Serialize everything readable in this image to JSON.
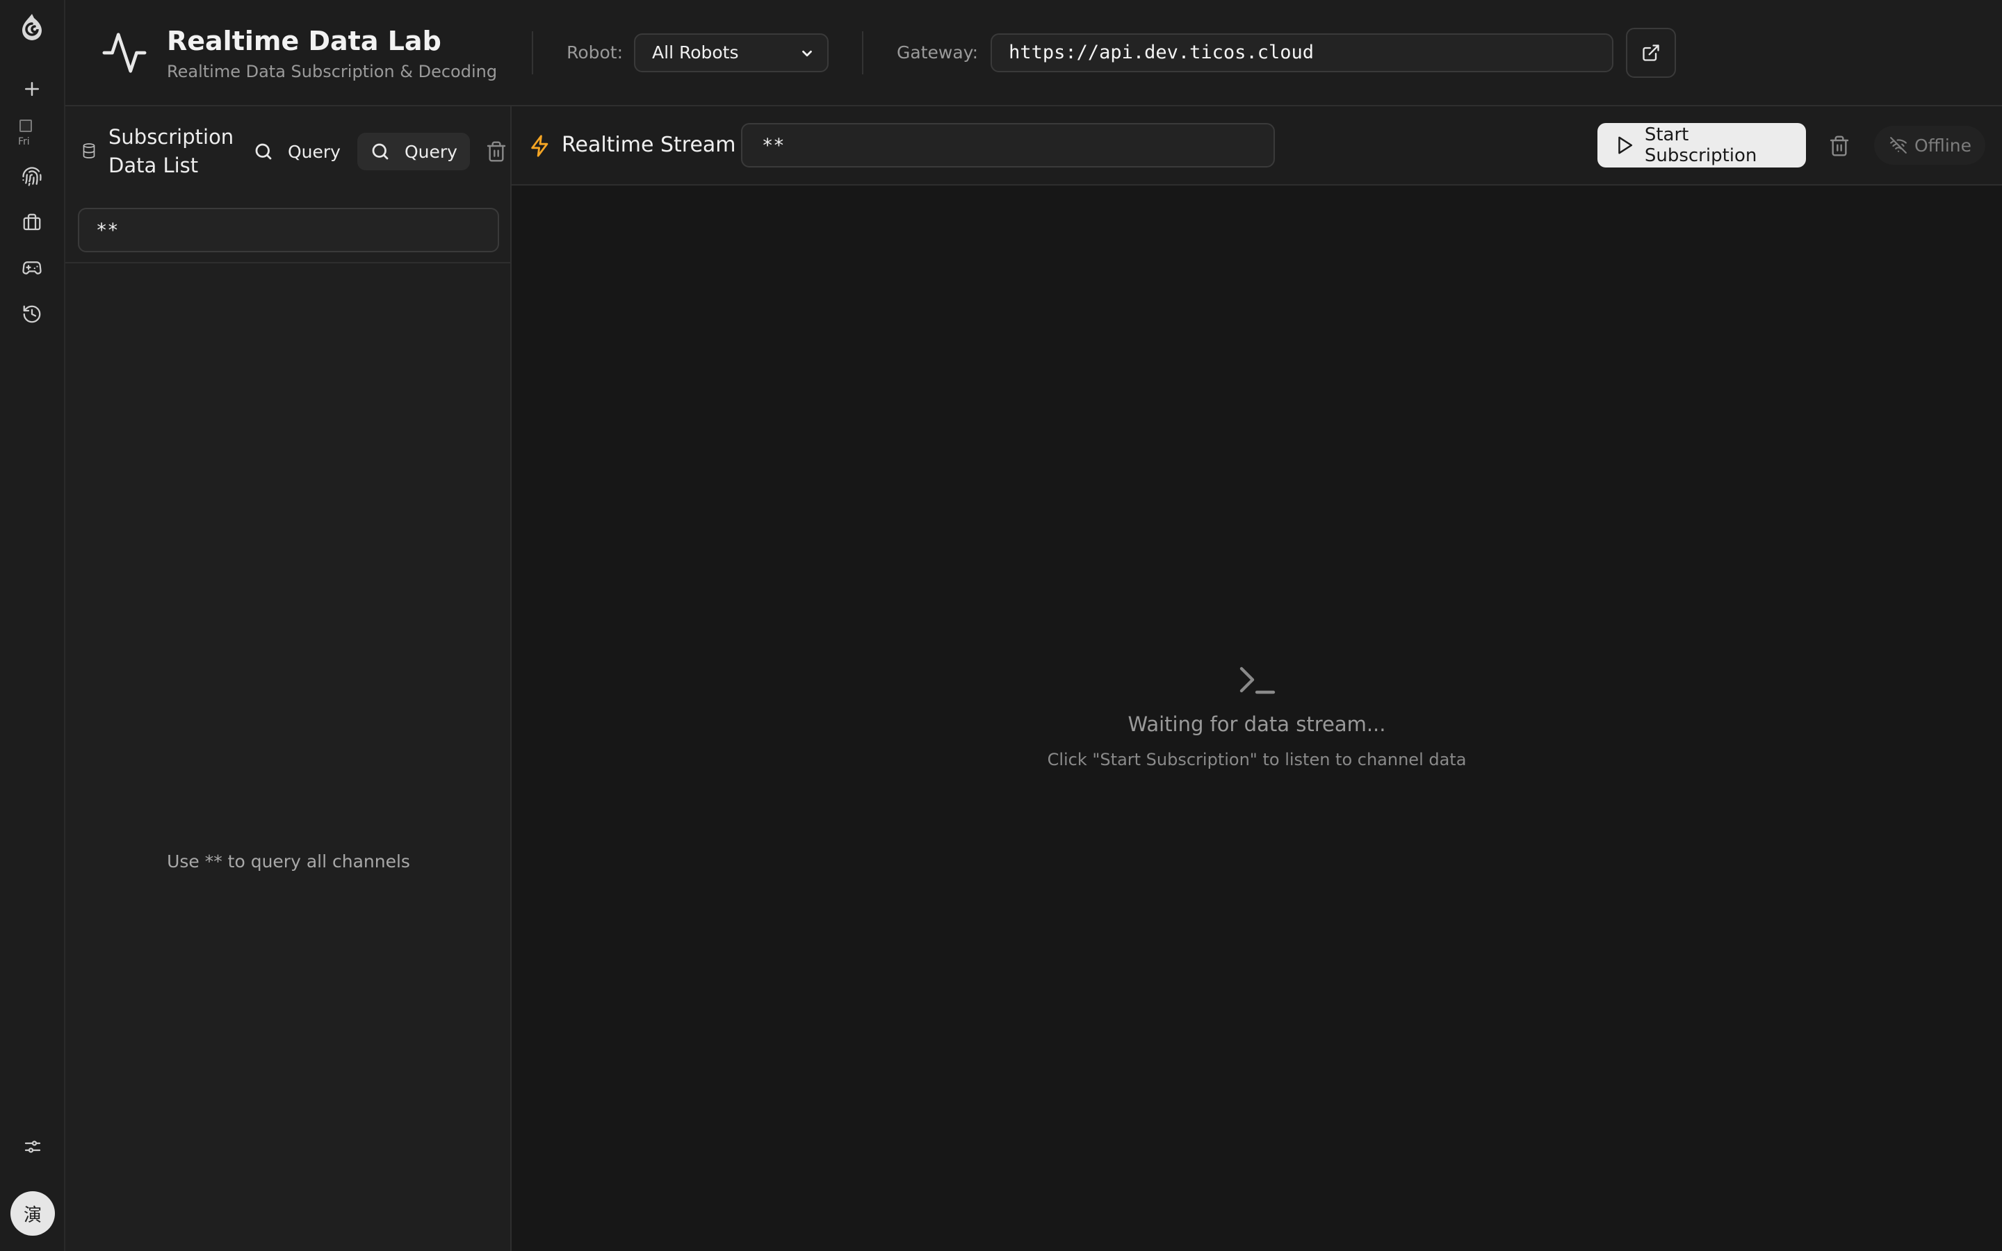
{
  "header": {
    "title": "Realtime Data Lab",
    "subtitle": "Realtime Data Subscription & Decoding",
    "robot_label": "Robot:",
    "robot_selected": "All Robots",
    "gateway_label": "Gateway:",
    "gateway_value": "https://api.dev.ticos.cloud"
  },
  "sidebar": {
    "image_alt": "Fri",
    "avatar_text": "演"
  },
  "subscription_panel": {
    "title": "Subscription Data List",
    "query_label": "Query",
    "query_active_label": "Query",
    "filter_value": "**",
    "empty_hint": "Use ** to query all channels"
  },
  "stream": {
    "title": "Realtime Stream",
    "filter_value": "**",
    "start_label": "Start Subscription",
    "status_label": "Offline",
    "empty_title": "Waiting for data stream...",
    "empty_subtitle": "Click \"Start Subscription\" to listen to channel data"
  },
  "colors": {
    "accent_bolt": "#f5a524",
    "background": "#171717",
    "primary_button": "#ececec"
  }
}
